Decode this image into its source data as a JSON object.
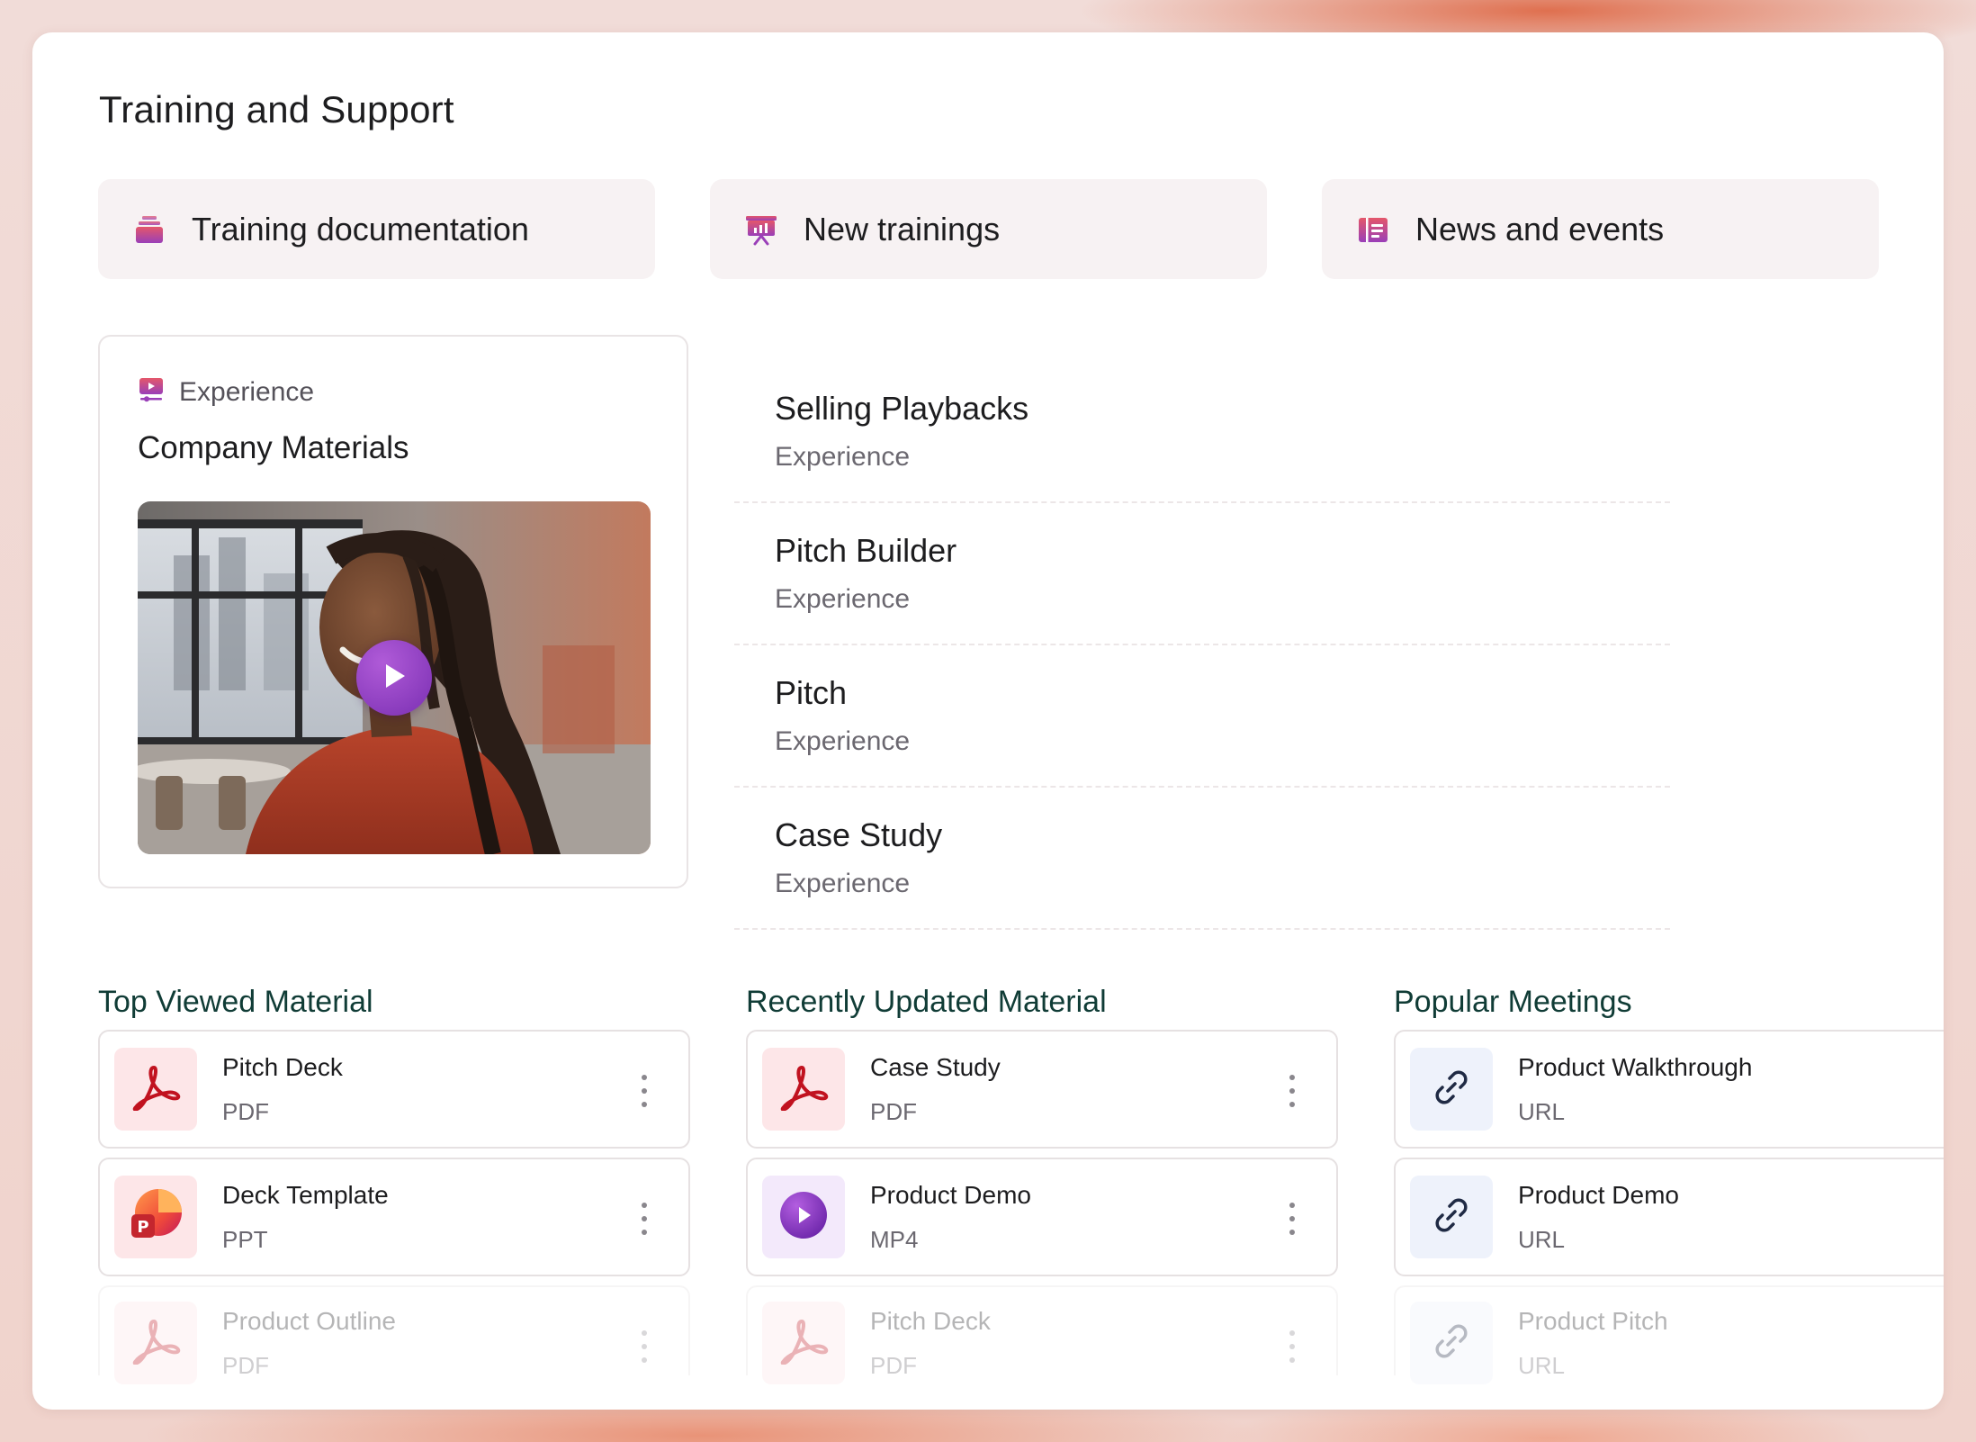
{
  "page": {
    "title": "Training and Support"
  },
  "quick_links": [
    {
      "label": "Training documentation",
      "icon": "stack-icon"
    },
    {
      "label": "New trainings",
      "icon": "presentation-icon"
    },
    {
      "label": "News and events",
      "icon": "newspaper-icon"
    }
  ],
  "featured": {
    "kicker": "Experience",
    "title": "Company Materials",
    "video_alt": "woman-smiling-video-thumbnail"
  },
  "experiences": [
    {
      "title": "Selling Playbacks",
      "subtitle": "Experience"
    },
    {
      "title": "Pitch Builder",
      "subtitle": "Experience"
    },
    {
      "title": "Pitch",
      "subtitle": "Experience"
    },
    {
      "title": "Case Study",
      "subtitle": "Experience"
    }
  ],
  "sections": {
    "top_viewed": {
      "heading": "Top Viewed Material",
      "items": [
        {
          "name": "Pitch Deck",
          "type": "PDF"
        },
        {
          "name": "Deck Template",
          "type": "PPT"
        },
        {
          "name": "Product Outline",
          "type": "PDF"
        }
      ]
    },
    "recently_updated": {
      "heading": "Recently Updated Material",
      "items": [
        {
          "name": "Case Study",
          "type": "PDF"
        },
        {
          "name": "Product Demo",
          "type": "MP4"
        },
        {
          "name": "Pitch Deck",
          "type": "PDF"
        }
      ]
    },
    "popular_meetings": {
      "heading": "Popular Meetings",
      "items": [
        {
          "name": "Product Walkthrough",
          "type": "URL"
        },
        {
          "name": "Product Demo",
          "type": "URL"
        },
        {
          "name": "Product Pitch",
          "type": "URL"
        }
      ]
    }
  },
  "colors": {
    "accent_gradient_start": "#e0554f",
    "accent_gradient_end": "#9b3fb8",
    "pdf_red": "#c1121f",
    "heading_teal": "#103c36"
  }
}
